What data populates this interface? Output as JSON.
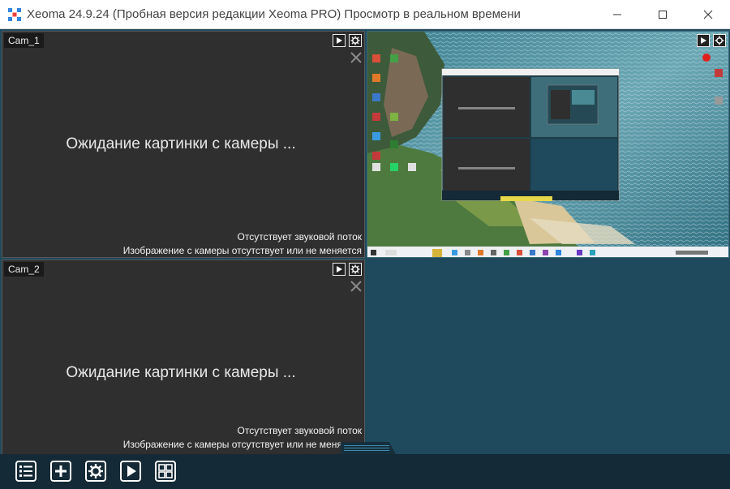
{
  "window": {
    "title": "Xeoma 24.9.24 (Пробная версия редакции Xeoma PRO) Просмотр в реальном времени",
    "controls": [
      "minimize-icon",
      "maximize-icon",
      "close-icon"
    ]
  },
  "cameras": [
    {
      "label": "Cam_1",
      "waiting": "Ожидание картинки с камеры ...",
      "status_audio": "Отсутствует звуковой поток",
      "status_image": "Изображение с камеры отсутствует или не меняется"
    },
    {
      "label": "Cam_2",
      "waiting": "Ожидание картинки с камеры ...",
      "status_audio": "Отсутствует звуковой поток",
      "status_image": "Изображение с камеры отсутствует или не меняется"
    }
  ],
  "preview_cell": {
    "content": "screen-capture-desktop",
    "recording": true,
    "rec_color": "#e0201c"
  },
  "toolbar": {
    "buttons": [
      "list-icon",
      "add-icon",
      "settings-gear-icon",
      "play-icon",
      "layout-grid-icon"
    ]
  },
  "colors": {
    "workspace_bg": "#1f4a5e",
    "cell_bg": "#2f2f2f",
    "toolbar_bg": "#142a36",
    "accent": "#3d8bb0"
  }
}
